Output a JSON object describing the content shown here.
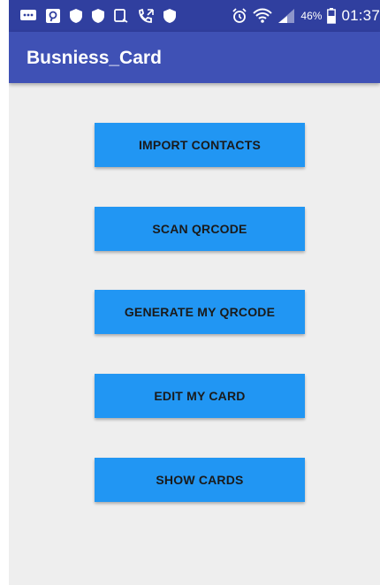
{
  "status_bar": {
    "left_icons": [
      "chat-bubble-icon",
      "pinterest-icon",
      "shield-icon",
      "shield-icon",
      "phone-forward-icon",
      "call-icon",
      "shield-icon"
    ],
    "right_icons": [
      "alarm-icon",
      "wifi-icon",
      "signal-icon",
      "battery-icon"
    ],
    "battery_percent": "46%",
    "time": "01:37"
  },
  "app_bar": {
    "title": "Busniess_Card"
  },
  "buttons": {
    "import_contacts": "IMPORT CONTACTS",
    "scan_qrcode": "SCAN QRCODE",
    "generate_qrcode": "GENERATE MY QRCODE",
    "edit_card": "EDIT MY CARD",
    "show_cards": "SHOW CARDS"
  },
  "colors": {
    "status_bar": "#303f9f",
    "app_bar": "#3f51b5",
    "button": "#2196f3",
    "background": "#eeeeee"
  }
}
